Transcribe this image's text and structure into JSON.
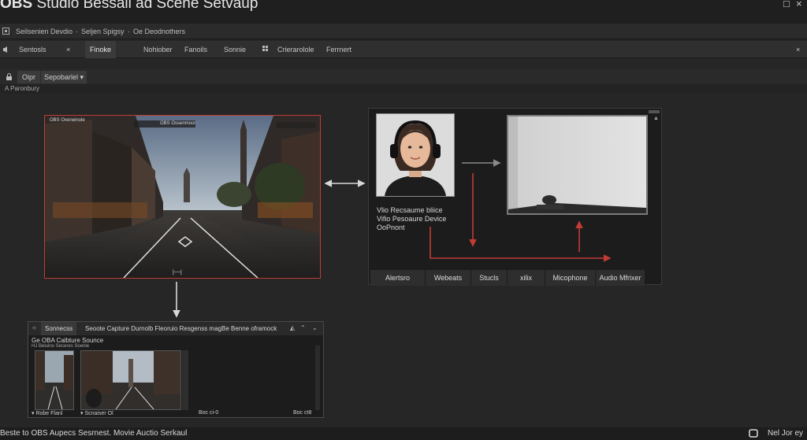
{
  "app": {
    "title_bold": "OBS",
    "title_rest": " Studio Bessall ad Scene Setvaup"
  },
  "window": {
    "minimize": "_",
    "maximize": "□",
    "close": "×"
  },
  "menu": {
    "item1": "Seilsenien Devdio",
    "sep1": "·",
    "item2": "Seljen Spigsy",
    "sep2": "·",
    "item3": "Oe Deodnothers"
  },
  "tabs": [
    {
      "label": "Sentosls"
    },
    {
      "label": "Finoke"
    },
    {
      "label": "Nohiober"
    },
    {
      "label": "Fanoils"
    },
    {
      "label": "Sonnie"
    },
    {
      "label": "Crierarolole"
    },
    {
      "label": "Ferrnert"
    }
  ],
  "tab_close": "×",
  "toolbar": {
    "lock_icon": "lock",
    "select1": "Oipr",
    "select2": "Sepobarlel"
  },
  "breadcrumb": "A Paronbury",
  "main_preview": {
    "title": "OBS Oxeneinole",
    "caption": "|~~|",
    "overlay_label": "OBS Ossenmoor"
  },
  "webcam_panel": {
    "label_lines": [
      "Vlio Recsaume bliice",
      "Vifio Pesoaure Device",
      "OoPnont"
    ],
    "buttons": [
      "Alertsro",
      "Webeats",
      "Stucls",
      "xilix",
      "Micophone",
      "Audio Mfrixer"
    ],
    "scroll_up": "▲"
  },
  "sources_panel": {
    "header_left": "Sonnecss",
    "header_title": "Seoote Capture Durnolb Fleoruio Resgenss magBe Benne oframock",
    "header_icons": [
      "gear",
      "chevron-up"
    ],
    "source_title": "Ge OBA Calbture Sounce",
    "source_sub": "HJ Beluino Seceres Soenle",
    "thumb1_label": "▾ Robe Flanl",
    "thumb2_label": "▾ Scnaiser Ol",
    "mid_label": "Boc ci-0",
    "right_label": "Boc ct8"
  },
  "status": {
    "left": "Beste to OBS Aupecs Sesrnest. Movie Auctio Serkaul",
    "right": "Nel Jor ey"
  },
  "colors": {
    "accent_red": "#c23b34",
    "panel_bg": "#1c1c1c",
    "window_bg": "#262626"
  }
}
